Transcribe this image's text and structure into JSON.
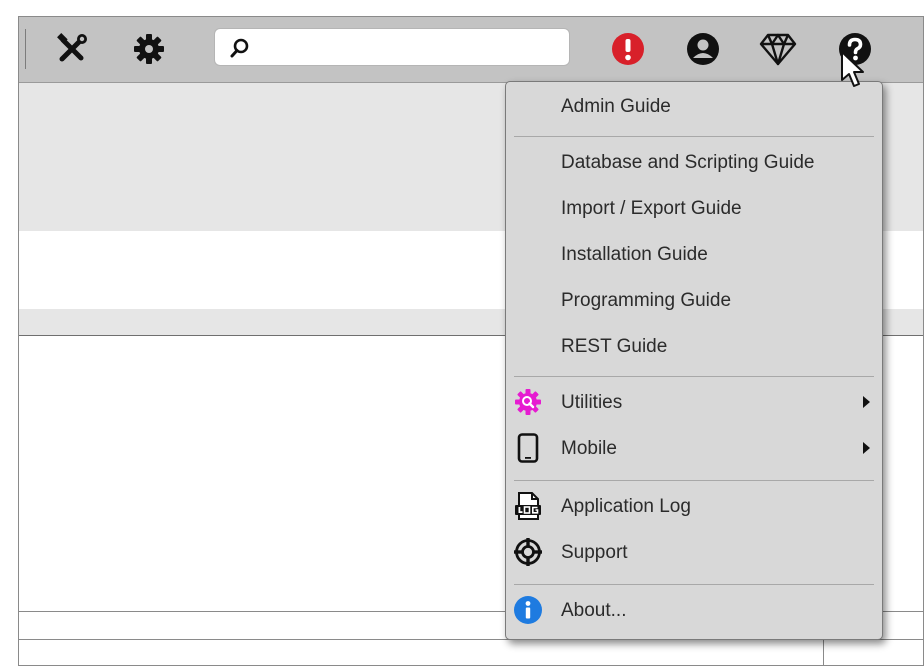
{
  "toolbar": {
    "icons": [
      "tools-icon",
      "gear-icon",
      "alert-icon",
      "user-icon",
      "diamond-icon",
      "help-icon"
    ],
    "search": {
      "value": "",
      "placeholder": ""
    },
    "colors": {
      "background": "#c3c3c3",
      "alert": "#d8202a"
    }
  },
  "help_menu": {
    "items": [
      {
        "label": "Admin Guide"
      },
      {
        "label": "Database and Scripting Guide"
      },
      {
        "label": "Import / Export Guide"
      },
      {
        "label": "Installation Guide"
      },
      {
        "label": "Programming Guide"
      },
      {
        "label": "REST Guide"
      },
      {
        "label": "Utilities",
        "icon": "utilities-gear-icon",
        "submenu": true
      },
      {
        "label": "Mobile",
        "icon": "mobile-phone-icon",
        "submenu": true
      },
      {
        "label": "Application Log",
        "icon": "log-file-icon"
      },
      {
        "label": "Support",
        "icon": "lifebuoy-icon"
      },
      {
        "label": "About...",
        "icon": "info-icon"
      }
    ],
    "colors": {
      "background": "#d8d8d8",
      "utilities_icon": "#e61bd1",
      "info_icon": "#1e7be0"
    }
  }
}
